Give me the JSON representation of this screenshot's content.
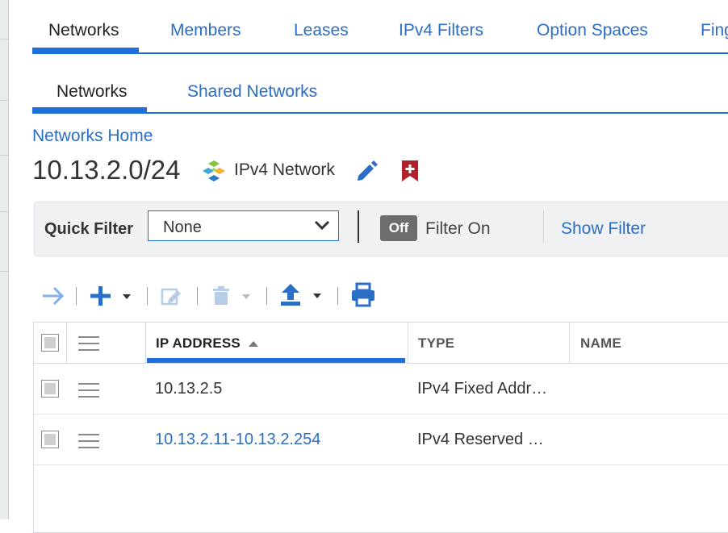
{
  "tabs_primary": [
    {
      "label": "Networks",
      "active": true
    },
    {
      "label": "Members",
      "active": false
    },
    {
      "label": "Leases",
      "active": false
    },
    {
      "label": "IPv4 Filters",
      "active": false
    },
    {
      "label": "Option Spaces",
      "active": false
    },
    {
      "label": "Fing",
      "active": false
    }
  ],
  "tabs_secondary": [
    {
      "label": "Networks",
      "active": true
    },
    {
      "label": "Shared Networks",
      "active": false
    }
  ],
  "breadcrumb": "Networks Home",
  "title": "10.13.2.0/24",
  "network_type": "IPv4 Network",
  "filter": {
    "quick_filter_label": "Quick Filter",
    "selected": "None",
    "toggle_label": "Off",
    "filter_on_label": "Filter On",
    "show_filter_label": "Show Filter"
  },
  "table": {
    "columns": [
      "IP ADDRESS",
      "TYPE",
      "NAME"
    ],
    "sorted_column": "IP ADDRESS",
    "rows": [
      {
        "ip": "10.13.2.5",
        "type": "IPv4 Fixed Addr…",
        "name": "",
        "ip_is_link": false
      },
      {
        "ip": "10.13.2.11-10.13.2.254",
        "type": "IPv4 Reserved …",
        "name": "",
        "ip_is_link": true
      }
    ]
  },
  "colors": {
    "accent": "#1e6fd9",
    "link": "#2a6ec6",
    "bookmark": "#b0202a"
  }
}
